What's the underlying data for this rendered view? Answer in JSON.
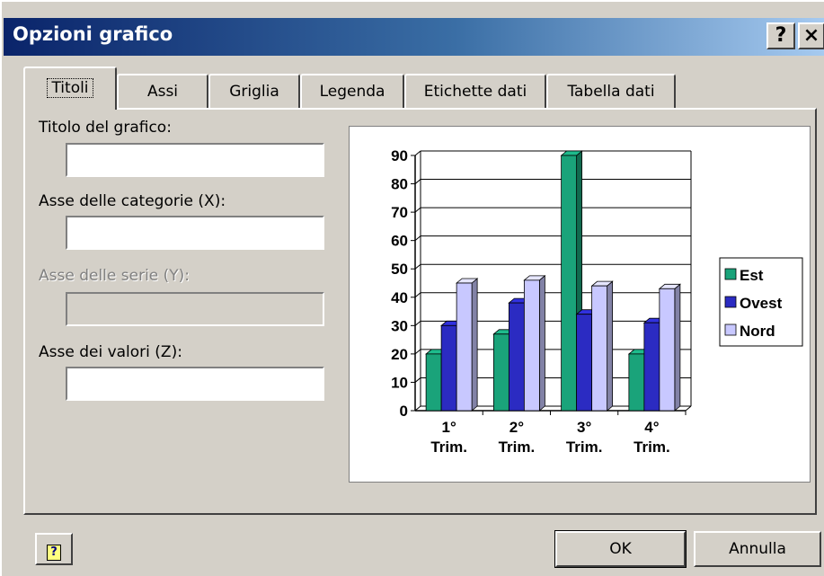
{
  "window": {
    "title": "Opzioni grafico",
    "help_glyph": "?",
    "close_glyph": "×"
  },
  "tabs": [
    {
      "label": "Titoli",
      "active": true
    },
    {
      "label": "Assi"
    },
    {
      "label": "Griglia"
    },
    {
      "label": "Legenda"
    },
    {
      "label": "Etichette dati"
    },
    {
      "label": "Tabella dati"
    }
  ],
  "fields": {
    "chart_title": {
      "label": "Titolo del grafico:",
      "value": ""
    },
    "category_axis": {
      "label": "Asse delle categorie (X):",
      "value": ""
    },
    "series_axis": {
      "label": "Asse delle serie (Y):",
      "value": "",
      "disabled": true
    },
    "value_axis": {
      "label": "Asse dei valori (Z):",
      "value": ""
    }
  },
  "buttons": {
    "ok": "OK",
    "cancel": "Annulla",
    "help_glyph": "?"
  },
  "chart_data": {
    "type": "bar",
    "categories": [
      "1° Trim.",
      "2° Trim.",
      "3° Trim.",
      "4° Trim."
    ],
    "category_lines": [
      [
        "1°",
        "Trim."
      ],
      [
        "2°",
        "Trim."
      ],
      [
        "3°",
        "Trim."
      ],
      [
        "4°",
        "Trim."
      ]
    ],
    "series": [
      {
        "name": "Est",
        "values": [
          20,
          27,
          90,
          20
        ],
        "color": "#1aa37a"
      },
      {
        "name": "Ovest",
        "values": [
          30,
          38,
          34,
          31
        ],
        "color": "#2b2bc2"
      },
      {
        "name": "Nord",
        "values": [
          45,
          46,
          44,
          43
        ],
        "color": "#c8c8ff"
      }
    ],
    "ylim": [
      0,
      90
    ],
    "yticks": [
      0,
      10,
      20,
      30,
      40,
      50,
      60,
      70,
      80,
      90
    ],
    "grid": true,
    "legend": "right",
    "style": "3d-columns"
  }
}
